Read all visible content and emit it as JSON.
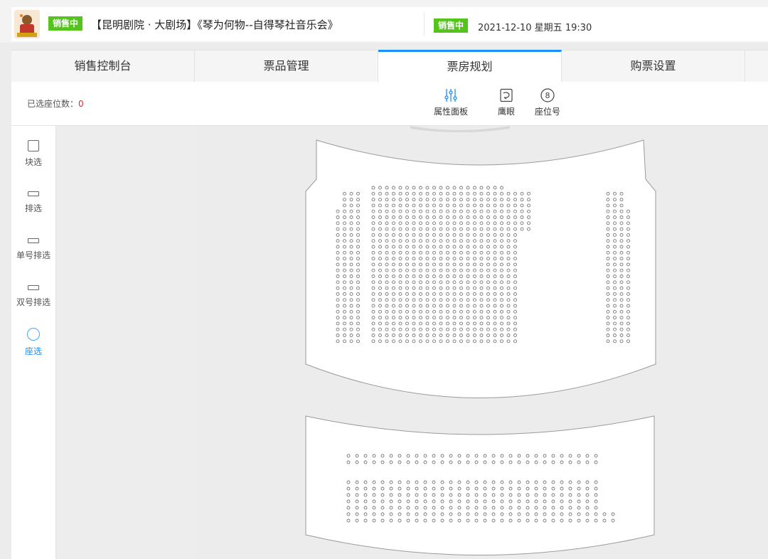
{
  "event": {
    "status_badge": "销售中",
    "title": "【昆明剧院 · 大剧场】《琴为何物--自得琴社音乐会》",
    "session_status_badge": "销售中",
    "session_datetime": "2021-12-10 星期五 19:30"
  },
  "tabs": [
    {
      "label": "销售控制台",
      "active": false
    },
    {
      "label": "票品管理",
      "active": false
    },
    {
      "label": "票房规划",
      "active": true
    },
    {
      "label": "购票设置",
      "active": false
    }
  ],
  "toolbar": {
    "selected_label": "已选座位数：",
    "selected_count": "0",
    "tools": [
      {
        "label": "属性面板",
        "icon": "sliders-icon"
      },
      {
        "label": "鹰眼",
        "icon": "eagle-eye-icon"
      },
      {
        "label": "座位号",
        "icon": "seat-number-icon",
        "glyph": "8"
      }
    ]
  },
  "select_modes": [
    {
      "label": "块选",
      "icon": "block-select-icon",
      "active": false
    },
    {
      "label": "排选",
      "icon": "row-select-icon",
      "active": false
    },
    {
      "label": "单号排选",
      "icon": "odd-row-select-icon",
      "active": false
    },
    {
      "label": "双号排选",
      "icon": "even-row-select-icon",
      "active": false
    },
    {
      "label": "座选",
      "icon": "seat-select-icon",
      "active": true
    }
  ],
  "colors": {
    "badge_green": "#52c41a",
    "accent_blue": "#1890ff",
    "count_red": "#f5222d",
    "seat_stroke": "#777777",
    "section_fill": "#ffffff"
  }
}
